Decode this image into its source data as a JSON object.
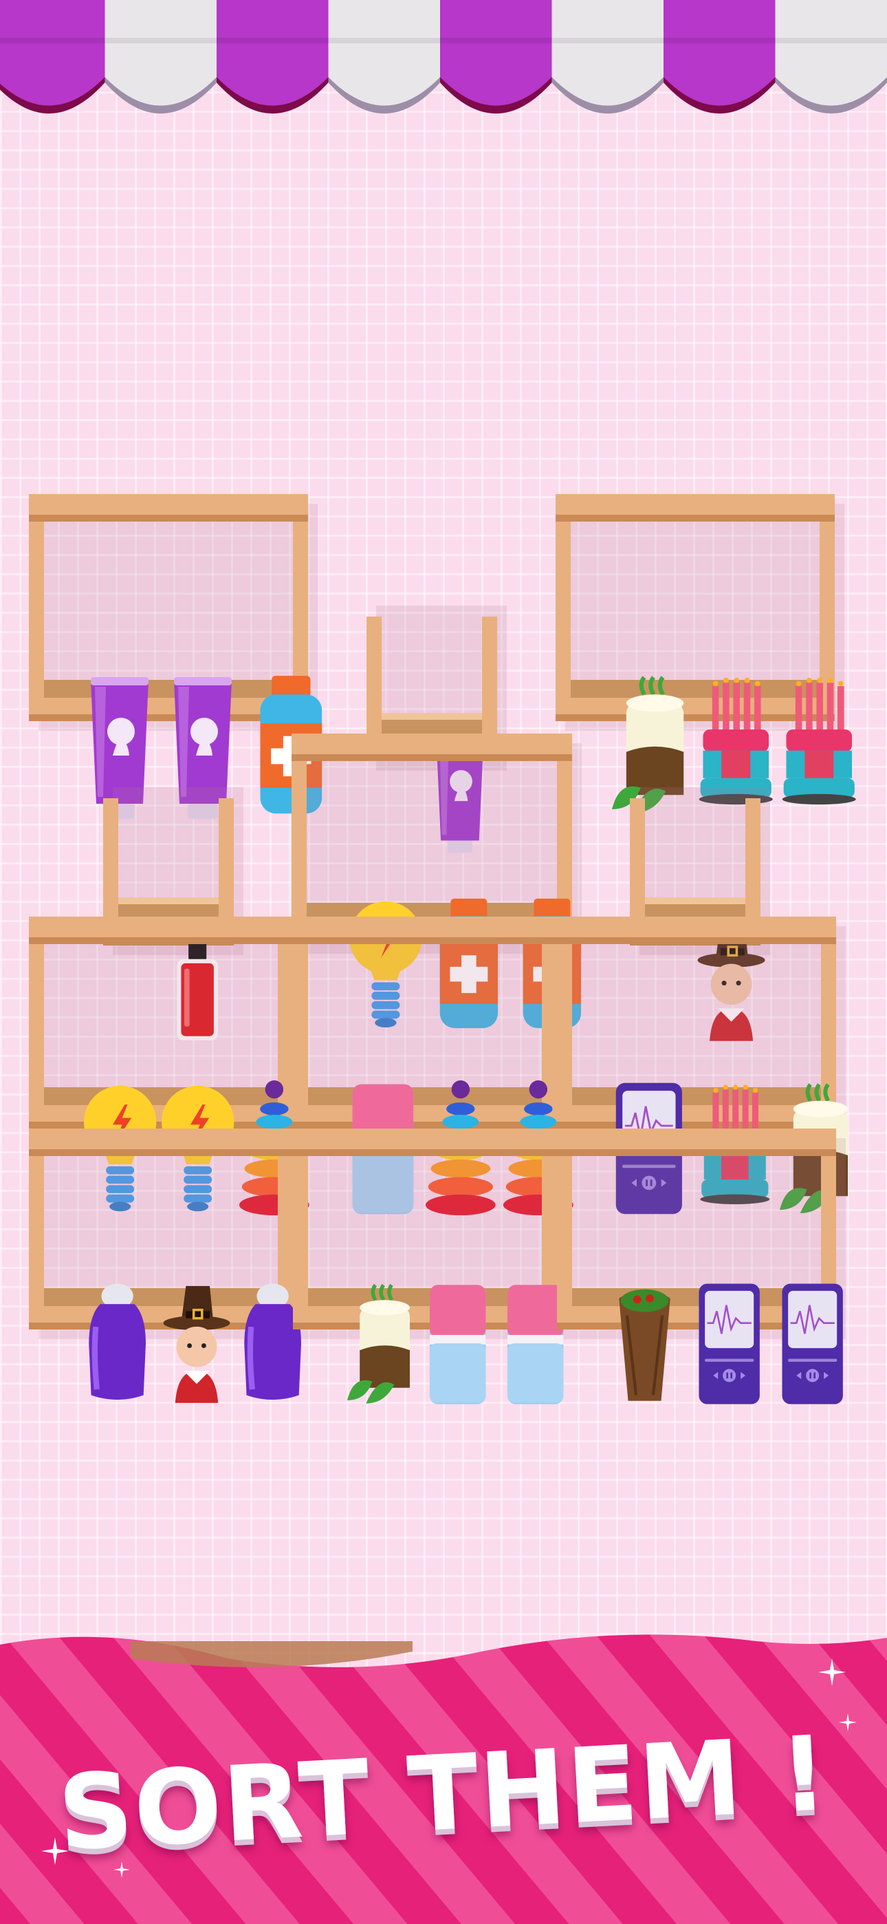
{
  "colors": {
    "background": "#fbdcec",
    "awning_purple": "#b637c9",
    "awning_white": "#e9e6ea",
    "wood_light": "#e8b07e",
    "wood_dark": "#c98a55",
    "banner_pink": "#e6217a"
  },
  "banner": {
    "title": "SORT THEM !"
  },
  "shelves": [
    {
      "id": "top-left",
      "slots": [
        "hand-cream-tube",
        "hand-cream-tube",
        "medicine-bottle"
      ]
    },
    {
      "id": "top-middle-small",
      "slots": [
        "hand-cream-tube"
      ]
    },
    {
      "id": "top-right",
      "slots": [
        "cake",
        "birthday-cake",
        "birthday-cake"
      ]
    },
    {
      "id": "middle-left-small",
      "slots": [
        "nail-polish"
      ]
    },
    {
      "id": "middle-center",
      "slots": [
        "light-bulb",
        "medicine-bottle",
        "medicine-bottle"
      ]
    },
    {
      "id": "middle-right-small",
      "slots": [
        "pilgrim-figure"
      ]
    },
    {
      "id": "row3-left",
      "slots": [
        "light-bulb",
        "light-bulb",
        "ring-stacker"
      ]
    },
    {
      "id": "row3-center",
      "slots": [
        "eraser",
        "ring-stacker",
        "ring-stacker"
      ]
    },
    {
      "id": "row3-right",
      "slots": [
        "music-player",
        "birthday-cake",
        "cake"
      ]
    },
    {
      "id": "row4-left",
      "slots": [
        "roll-on-deodorant",
        "pilgrim-figure",
        "roll-on-deodorant"
      ]
    },
    {
      "id": "row4-center",
      "slots": [
        "cake",
        "eraser",
        "eraser"
      ]
    },
    {
      "id": "row4-right",
      "slots": [
        "burrito",
        "music-player",
        "music-player"
      ]
    }
  ]
}
